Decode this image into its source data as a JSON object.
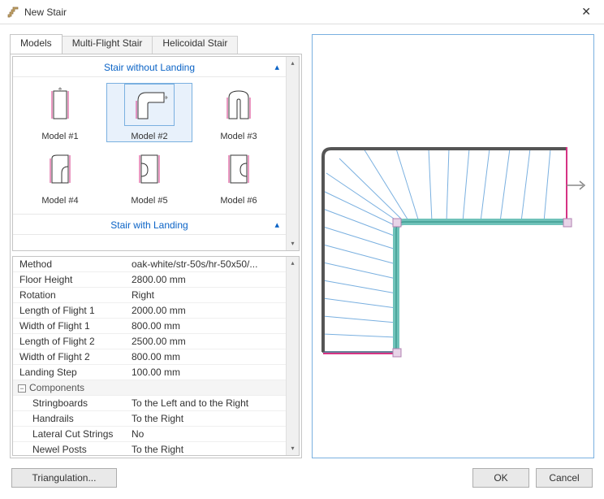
{
  "window": {
    "title": "New Stair",
    "close_glyph": "✕"
  },
  "tabs": {
    "models": "Models",
    "multi": "Multi-Flight Stair",
    "helicoidal": "Helicoidal Stair"
  },
  "groups": {
    "without_landing": "Stair without Landing",
    "with_landing": "Stair with Landing"
  },
  "models_without_landing": [
    {
      "label": "Model #1"
    },
    {
      "label": "Model #2"
    },
    {
      "label": "Model #3"
    },
    {
      "label": "Model #4"
    },
    {
      "label": "Model #5"
    },
    {
      "label": "Model #6"
    }
  ],
  "props": {
    "method": {
      "key": "Method",
      "val": "oak-white/str-50s/hr-50x50/..."
    },
    "floor_height": {
      "key": "Floor Height",
      "val": "2800.00 mm"
    },
    "rotation": {
      "key": "Rotation",
      "val": "Right"
    },
    "len_f1": {
      "key": "Length of Flight 1",
      "val": "2000.00 mm"
    },
    "wid_f1": {
      "key": "Width of Flight 1",
      "val": "800.00 mm"
    },
    "len_f2": {
      "key": "Length of Flight 2",
      "val": "2500.00 mm"
    },
    "wid_f2": {
      "key": "Width of Flight 2",
      "val": "800.00 mm"
    },
    "landing_step": {
      "key": "Landing Step",
      "val": "100.00 mm"
    },
    "components_group": "Components",
    "stringboards": {
      "key": "Stringboards",
      "val": "To the Left and to the Right"
    },
    "handrails": {
      "key": "Handrails",
      "val": "To the Right"
    },
    "lateral": {
      "key": "Lateral Cut Strings",
      "val": "No"
    },
    "newel": {
      "key": "Newel Posts",
      "val": "To the Right"
    }
  },
  "buttons": {
    "triangulation": "Triangulation...",
    "ok": "OK",
    "cancel": "Cancel"
  }
}
